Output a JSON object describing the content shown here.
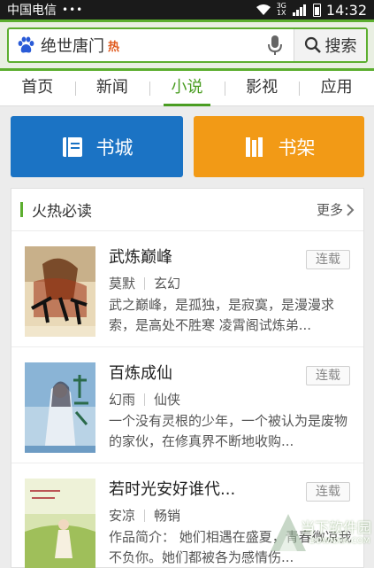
{
  "status_bar": {
    "carrier": "中国电信",
    "dots": "•••",
    "network": "3G",
    "network_sub": "1X",
    "time": "14:32"
  },
  "search": {
    "query": "绝世唐门",
    "hot_badge": "热",
    "button_label": "搜索"
  },
  "tabs": [
    {
      "label": "首页"
    },
    {
      "label": "新闻"
    },
    {
      "label": "小说",
      "active": true
    },
    {
      "label": "影视"
    },
    {
      "label": "应用"
    }
  ],
  "actions": {
    "bookstore_label": "书城",
    "bookshelf_label": "书架",
    "bookstore_color": "#1b73c4",
    "bookshelf_color": "#f29a16"
  },
  "section": {
    "title": "火热必读",
    "more_label": "更多"
  },
  "books": [
    {
      "title": "武炼巅峰",
      "author": "莫默",
      "genre": "玄幻",
      "status": "连载",
      "description": "武之巅峰，是孤独，是寂寞，是漫漫求索，是高处不胜寒 凌霄阁试炼弟..."
    },
    {
      "title": "百炼成仙",
      "author": "幻雨",
      "genre": "仙侠",
      "status": "连载",
      "description": "一个没有灵根的少年，一个被认为是废物的家伙，在修真界不断地收购..."
    },
    {
      "title": "若时光安好谁代...",
      "author": "安凉",
      "genre": "畅销",
      "status": "连载",
      "description": "作品简介： 她们相遇在盛夏，青春微凉我不负你。她们都被各为感情伤..."
    }
  ],
  "watermark": {
    "text": "当下软件园",
    "sub": "DOWNXIA.COM"
  },
  "colors": {
    "accent_green": "#5cae2f",
    "active_tab": "#4a9d22"
  }
}
